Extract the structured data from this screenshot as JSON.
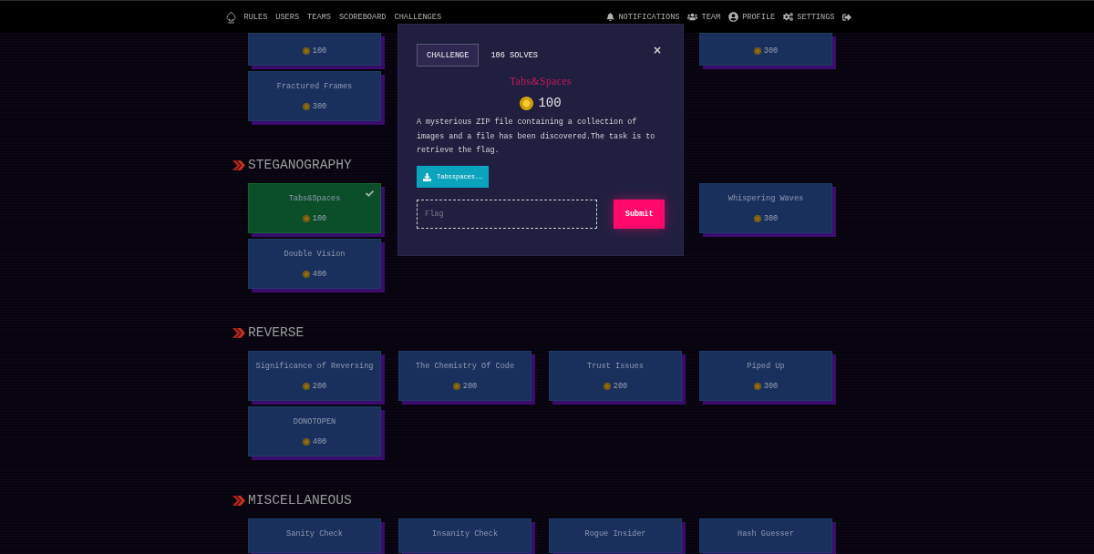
{
  "nav": {
    "links": [
      "RULES",
      "USERS",
      "TEAMS",
      "SCOREBOARD",
      "CHALLENGES"
    ],
    "user_links": [
      "NOTIFICATIONS",
      "TEAM",
      "PROFILE",
      "SETTINGS"
    ]
  },
  "sections": [
    {
      "behind_dialog": true,
      "cards": [
        {
          "points": "100",
          "solved": false
        },
        {
          "points": "300",
          "solved": false
        },
        {
          "title": "Fractured Frames",
          "points": "300",
          "solved": false
        }
      ]
    },
    {
      "name": "STEGANOGRAPHY",
      "behind_dialog": true,
      "cards": [
        {
          "title": "Tabs&Spaces",
          "points": "100",
          "solved": true
        },
        {
          "title": "Whispering Waves",
          "points": "300",
          "solved": false
        },
        {
          "title": "Double Vision",
          "points": "400",
          "solved": false
        }
      ]
    },
    {
      "name": "REVERSE",
      "behind_dialog": false,
      "cards": [
        {
          "title": "Significance of Reversing",
          "points": "200",
          "solved": false
        },
        {
          "title": "The Chemistry Of Code",
          "points": "200",
          "solved": false
        },
        {
          "title": "Trust Issues",
          "points": "200",
          "solved": false
        },
        {
          "title": "Piped Up",
          "points": "300",
          "solved": false
        },
        {
          "title": "DONOTOPEN",
          "points": "400",
          "solved": false
        }
      ]
    },
    {
      "name": "MISCELLANEOUS",
      "behind_dialog": false,
      "cards": [
        {
          "title": "Sanity Check",
          "solved": false
        },
        {
          "title": "Insanity Check",
          "solved": false
        },
        {
          "title": "Rogue Insider",
          "solved": false
        },
        {
          "title": "Hash Guesser",
          "solved": false
        }
      ]
    }
  ],
  "dialog": {
    "tabs": [
      {
        "label": "CHALLENGE",
        "selected": true
      },
      {
        "label": "106 SOLVES",
        "selected": false
      }
    ],
    "close": "×",
    "title": "Tabs&Spaces",
    "points": "100",
    "description": "A mysterious ZIP file containing a collection of images and a file has been discovered.The task is to retrieve the flag.",
    "file": "Tabsspaces.…",
    "flag": {
      "placeholder": "Flag"
    },
    "submit": "Submit"
  }
}
